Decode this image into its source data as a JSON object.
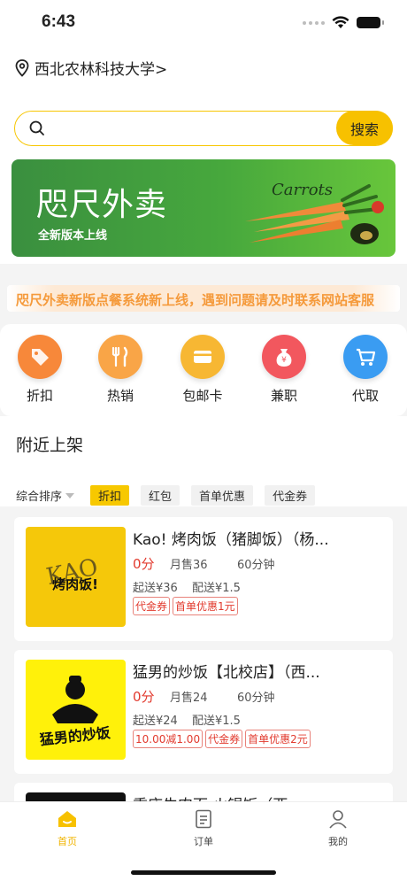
{
  "status_bar": {
    "time": "6:43"
  },
  "header": {
    "location": "西北农林科技大学>",
    "search_button": "搜索",
    "search_placeholder": ""
  },
  "banner": {
    "title": "咫尺外卖",
    "subtitle": "全新版本上线",
    "art_text": "Carrots"
  },
  "notice": {
    "text": "咫尺外卖新版点餐系统新上线，遇到问题请及时联系网站客服"
  },
  "categories": [
    {
      "label": "折扣",
      "icon": "tag-icon",
      "color": "#f7883a"
    },
    {
      "label": "热销",
      "icon": "fork-knife-icon",
      "color": "#f9a547"
    },
    {
      "label": "包邮卡",
      "icon": "card-icon",
      "color": "#f7b733"
    },
    {
      "label": "兼职",
      "icon": "money-bag-icon",
      "color": "#f2575e"
    },
    {
      "label": "代取",
      "icon": "cart-icon",
      "color": "#3a9cf2"
    }
  ],
  "nearby": {
    "title": "附近上架",
    "sort_label": "综合排序",
    "filters": [
      "折扣",
      "红包",
      "首单优惠",
      "代金券"
    ]
  },
  "shops": [
    {
      "name": "Kao! 烤肉饭（猪脚饭）（杨...",
      "score": "0分",
      "monthly_sales": "月售36",
      "delivery_time": "60分钟",
      "min_order": "起送¥36",
      "delivery_fee": "配送¥1.5",
      "tags": [
        "代金券",
        "首单优惠1元"
      ],
      "logo_text_top": "KAO",
      "logo_text_main": "烤肉饭!",
      "logo_bg": "#f5c80a"
    },
    {
      "name": "猛男的炒饭【北校店】（西...",
      "score": "0分",
      "monthly_sales": "月售24",
      "delivery_time": "60分钟",
      "min_order": "起送¥24",
      "delivery_fee": "配送¥1.5",
      "tags": [
        "10.00减1.00",
        "代金券",
        "首单优惠2元"
      ],
      "logo_text_main": "猛男的炒饭",
      "logo_bg": "#fff10a"
    },
    {
      "name": "重庆牛肉面·火锅饭（西...",
      "logo_bg": "#111111"
    }
  ],
  "tabbar": [
    {
      "label": "首页",
      "icon": "home-icon",
      "active": true
    },
    {
      "label": "订单",
      "icon": "order-icon",
      "active": false
    },
    {
      "label": "我的",
      "icon": "profile-icon",
      "active": false
    }
  ]
}
